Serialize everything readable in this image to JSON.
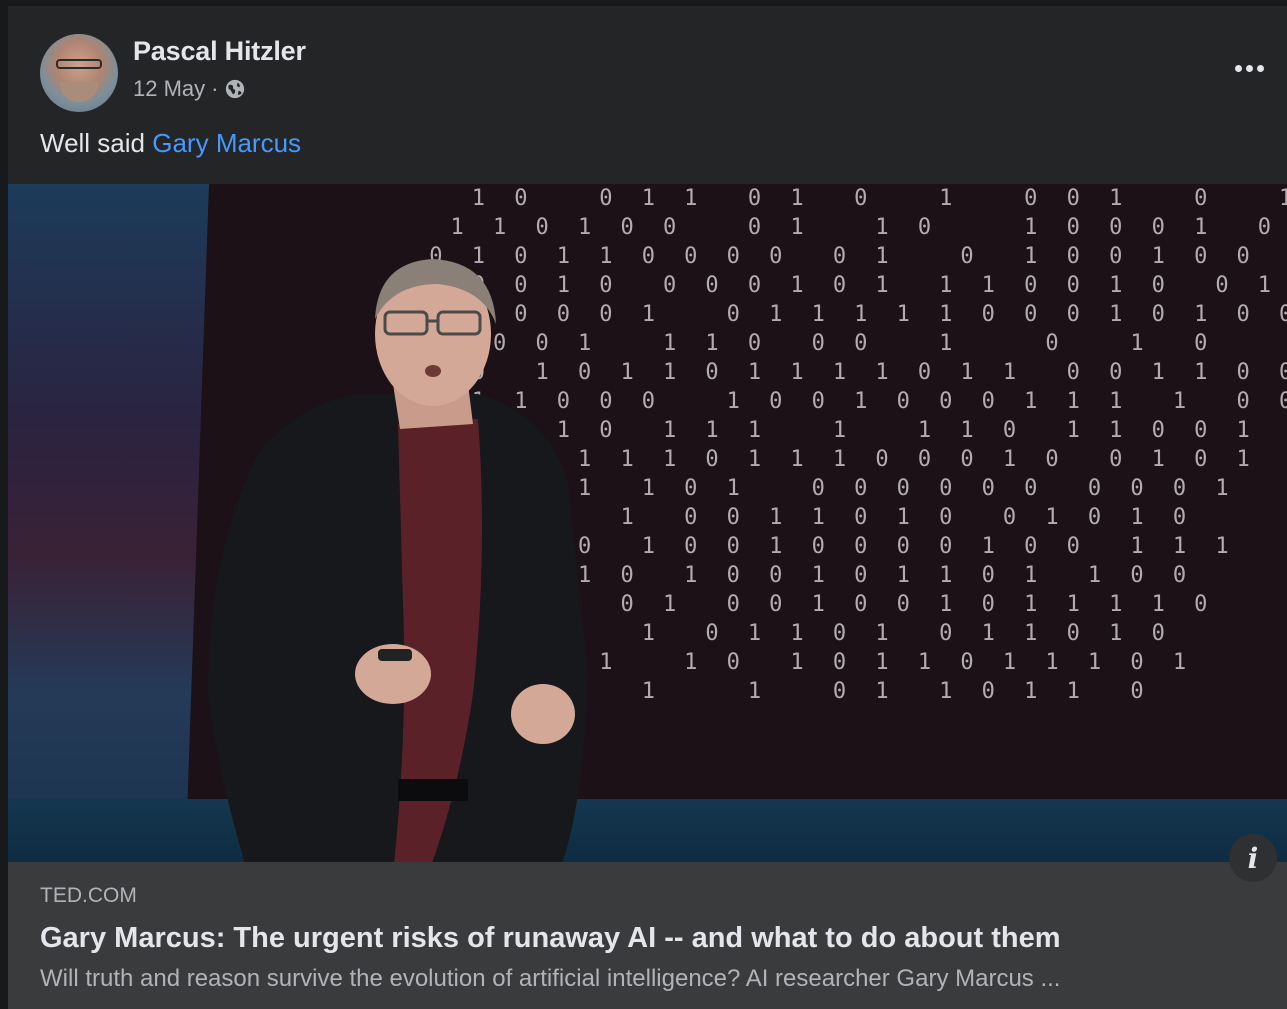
{
  "post": {
    "author_name": "Pascal Hitzler",
    "date": "12 May",
    "separator": "·",
    "audience_icon": "globe-icon",
    "text_prefix": "Well said",
    "mention": "Gary Marcus",
    "more_icon": "more-horizontal-icon"
  },
  "link_preview": {
    "domain": "TED.COM",
    "title": "Gary Marcus: The urgent risks of runaway AI -- and what to do about them",
    "description": "Will truth and reason survive the evolution of artificial intelligence? AI researcher Gary Marcus ...",
    "info_icon": "i"
  },
  "colors": {
    "page_bg": "#18191a",
    "card_bg": "#242526",
    "link_bg": "#3a3b3c",
    "primary_text": "#e4e6eb",
    "secondary_text": "#b0b3b8",
    "mention": "#4599ff"
  }
}
